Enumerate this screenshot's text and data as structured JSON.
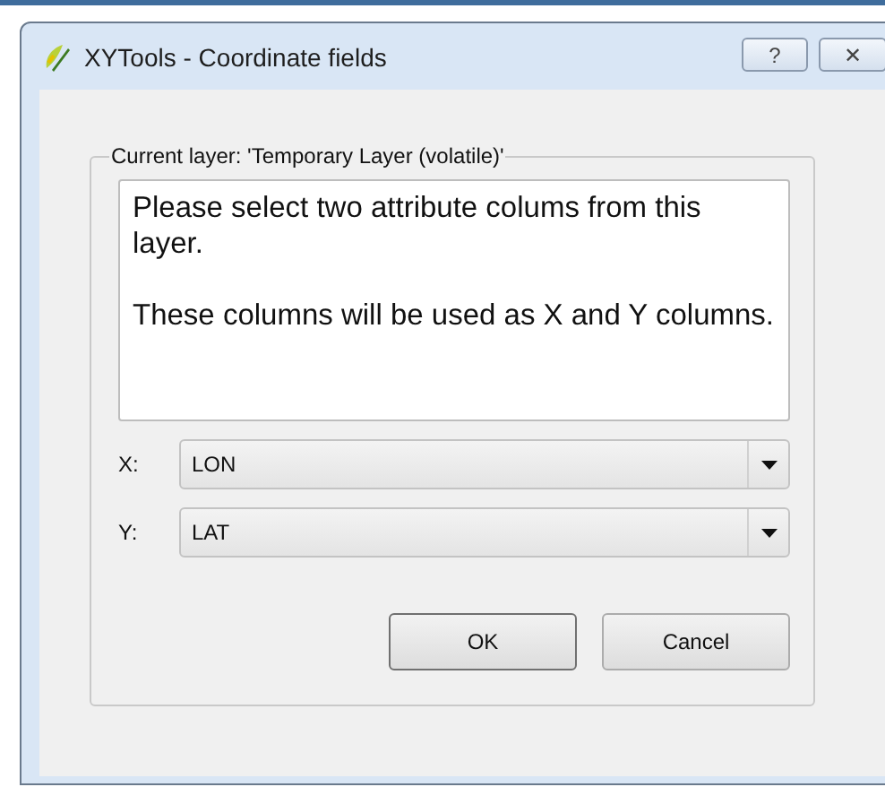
{
  "window": {
    "title": "XYTools - Coordinate fields",
    "buttons": [
      "?",
      "✕"
    ]
  },
  "group": {
    "title": "Current layer: 'Temporary Layer (volatile)'"
  },
  "message": [
    "Please select two attribute colums from this layer.",
    "These columns will be used as X and Y columns."
  ],
  "fields": [
    {
      "label": "X:",
      "value": "LON"
    },
    {
      "label": "Y:",
      "value": "LAT"
    }
  ],
  "buttons": [
    {
      "label": "OK",
      "default": true
    },
    {
      "label": "Cancel",
      "default": false
    }
  ]
}
